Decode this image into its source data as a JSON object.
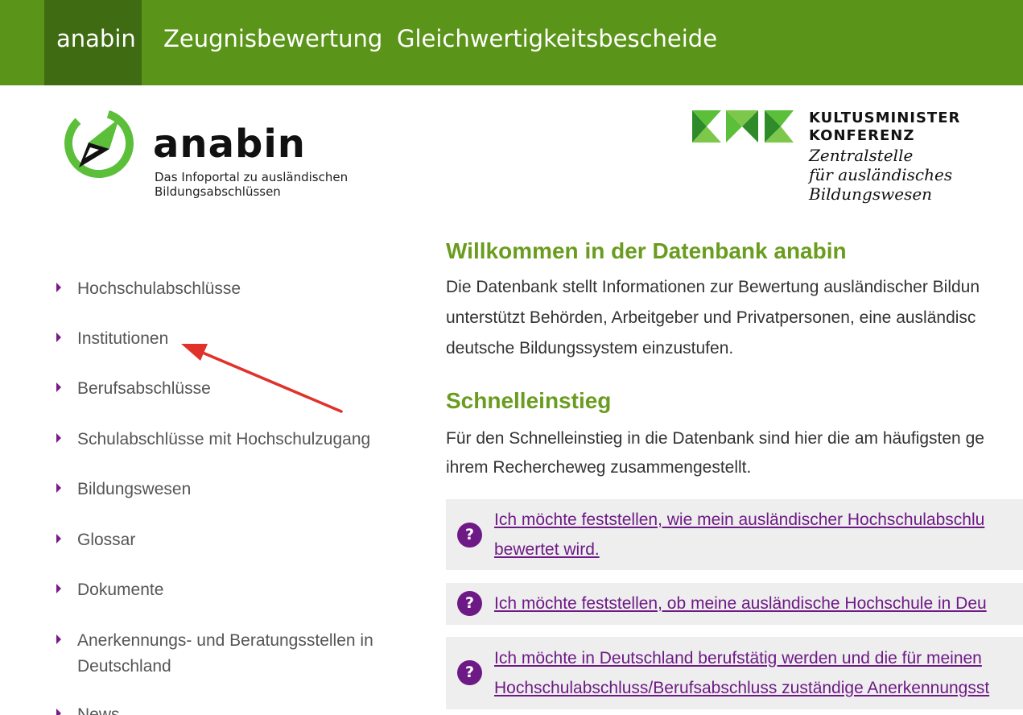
{
  "topnav": {
    "items": [
      {
        "label": "anabin",
        "active": true
      },
      {
        "label": "Zeugnisbewertung",
        "active": false
      },
      {
        "label": "Gleichwertigkeitsbescheide",
        "active": false
      }
    ],
    "bg_color": "#5a9419",
    "active_color": "#3f6b12"
  },
  "logo_anabin": {
    "wordmark": "anabin",
    "subtitle_line1": "Das Infoportal zu ausländischen",
    "subtitle_line2": "Bildungsabschlüssen"
  },
  "logo_kmk": {
    "title_line1": "KULTUSMINISTER",
    "title_line2": "KONFERENZ",
    "sub_line1": "Zentralstelle",
    "sub_line2": "für ausländisches",
    "sub_line3": "Bildungswesen"
  },
  "sidebar": {
    "items": [
      {
        "label": "Hochschulabschlüsse"
      },
      {
        "label": "Institutionen"
      },
      {
        "label": "Berufsabschlüsse"
      },
      {
        "label": "Schulabschlüsse mit Hochschulzugang"
      },
      {
        "label": "Bildungswesen"
      },
      {
        "label": "Glossar"
      },
      {
        "label": "Dokumente"
      },
      {
        "label": "Anerkennungs- und Beratungsstellen in Deutschland"
      },
      {
        "label": "News"
      }
    ]
  },
  "main": {
    "welcome_title": "Willkommen in der Datenbank anabin",
    "welcome_line1": "Die Datenbank stellt Informationen zur Bewertung ausländischer Bildun",
    "welcome_line2": "unterstützt Behörden, Arbeitgeber und Privatpersonen, eine ausländisc",
    "welcome_line3": "deutsche Bildungssystem einzustufen.",
    "schnell_title": "Schnelleinstieg",
    "schnell_line1": "Für den Schnelleinstieg in die Datenbank sind hier die am häufigsten ge",
    "schnell_line2": "ihrem Rechercheweg zusammengestellt.",
    "questions": [
      {
        "icon": "?",
        "line1": "Ich möchte feststellen, wie mein ausländischer Hochschulabschlu",
        "line2": "bewertet wird."
      },
      {
        "icon": "?",
        "line1": "Ich möchte feststellen, ob meine ausländische Hochschule in Deu"
      },
      {
        "icon": "?",
        "line1": "Ich möchte in Deutschland berufstätig werden und die für meinen",
        "line2": "Hochschulabschluss/Berufsabschluss zuständige Anerkennungsst"
      }
    ]
  },
  "colors": {
    "heading_green": "#6a9c1f",
    "link_purple": "#6e1a86",
    "annotation_red": "#e0322b"
  }
}
